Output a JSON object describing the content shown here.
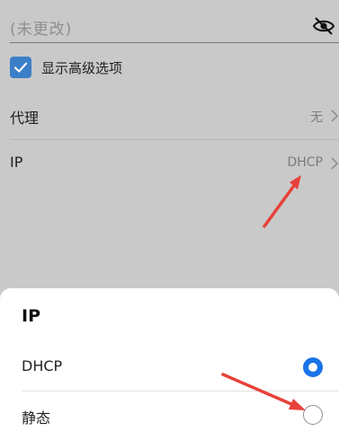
{
  "password": {
    "placeholder": "(未更改)",
    "visibility_icon": "eye-off-icon"
  },
  "advanced": {
    "label": "显示高级选项",
    "checked": true
  },
  "proxy": {
    "label": "代理",
    "value": "无"
  },
  "ip": {
    "label": "IP",
    "value": "DHCP"
  },
  "sheet": {
    "title": "IP",
    "options": [
      {
        "label": "DHCP",
        "selected": true
      },
      {
        "label": "静态",
        "selected": false
      }
    ]
  },
  "colors": {
    "accent": "#1a73e8",
    "checkbox": "#3b7fc7",
    "annotation": "#e8403a"
  }
}
